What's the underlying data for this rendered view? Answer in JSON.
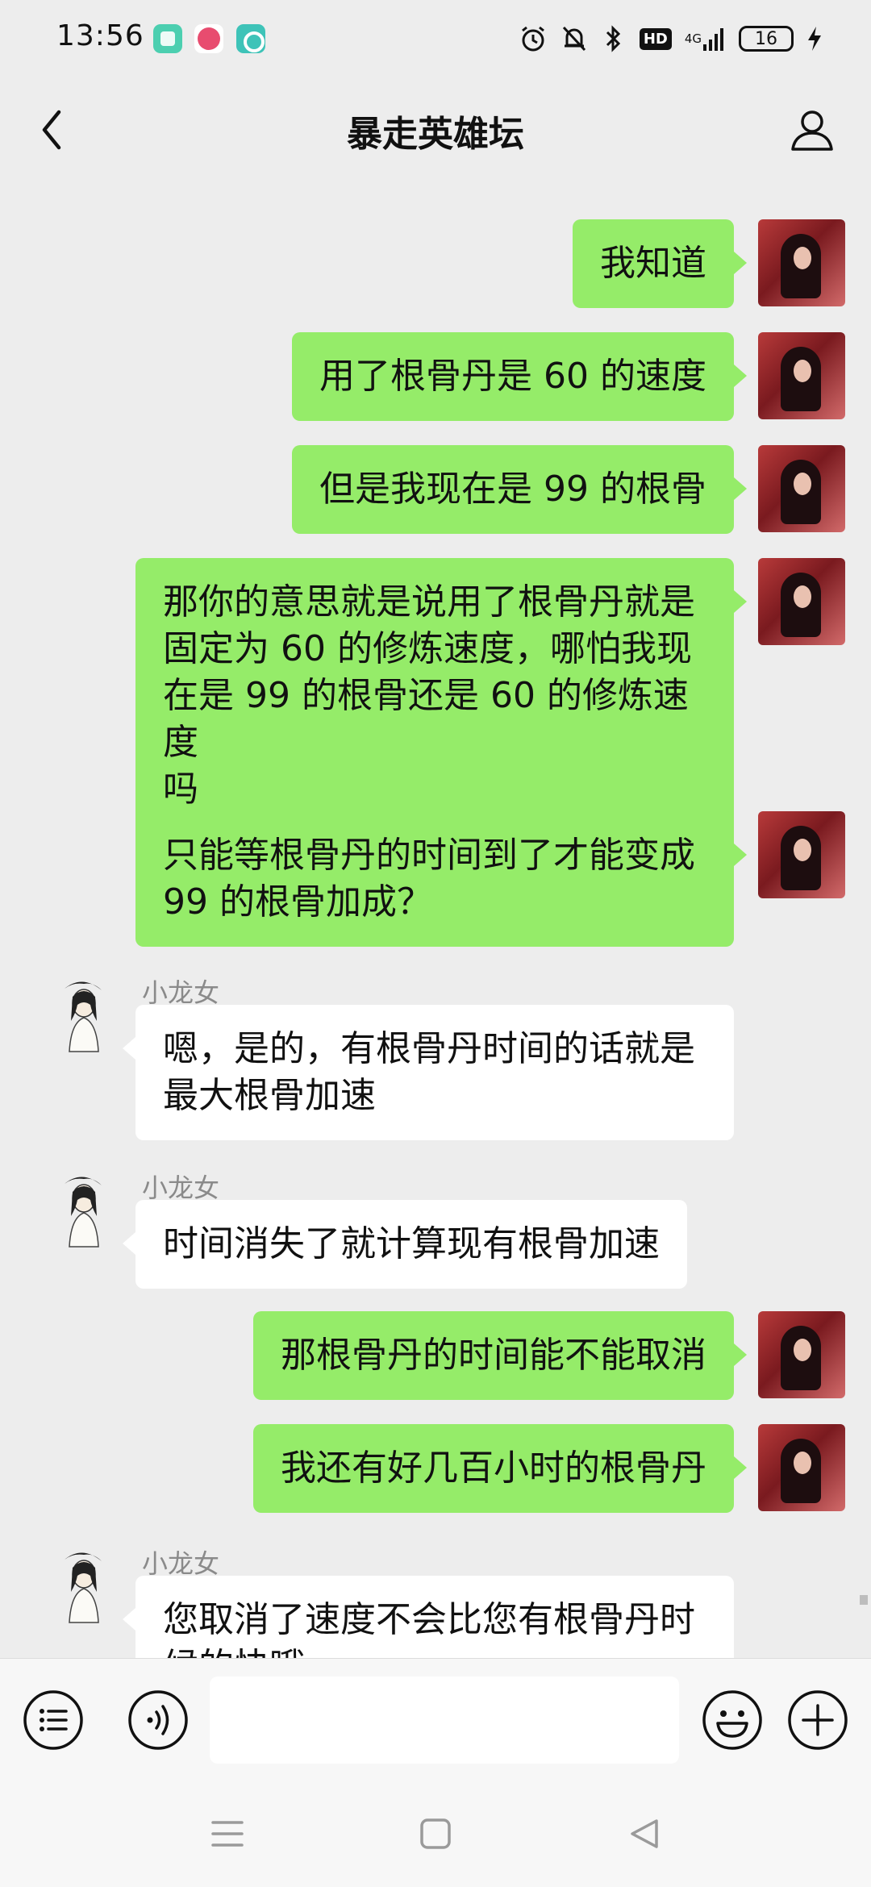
{
  "status_bar": {
    "time": "13:56",
    "hd": "HD",
    "network": "4G",
    "battery": "16"
  },
  "header": {
    "title": "暴走英雄坛"
  },
  "messages": [
    {
      "side": "self",
      "text": "我知道"
    },
    {
      "side": "self",
      "text": "用了根骨丹是 60 的速度"
    },
    {
      "side": "self",
      "text": "但是我现在是 99 的根骨"
    },
    {
      "side": "self",
      "lines": [
        "那你的意思就是说用了根骨丹就是",
        "固定为 60 的修炼速度，哪怕我现",
        "在是 99 的根骨还是 60 的修炼速度",
        "吗"
      ]
    },
    {
      "side": "self",
      "lines": [
        "只能等根骨丹的时间到了才能变成",
        "99 的根骨加成？"
      ]
    },
    {
      "side": "other",
      "name": "小龙女",
      "lines": [
        "嗯，是的，有根骨丹时间的话就是",
        "最大根骨加速"
      ]
    },
    {
      "side": "other",
      "name": "小龙女",
      "text": "时间消失了就计算现有根骨加速"
    },
    {
      "side": "self",
      "text": "那根骨丹的时间能不能取消"
    },
    {
      "side": "self",
      "text": "我还有好几百小时的根骨丹"
    },
    {
      "side": "other",
      "name": "小龙女",
      "lines": [
        "您取消了速度不会比您有根骨丹时",
        "候的快哦"
      ]
    }
  ],
  "input_bar": {
    "placeholder": ""
  },
  "icons": {
    "back": "chevron-left-icon",
    "profile": "person-icon",
    "menu": "list-icon",
    "voice": "voice-icon",
    "emoji": "emoji-icon",
    "add": "plus-icon"
  },
  "colors": {
    "self_bubble": "#95ec69",
    "other_bubble": "#ffffff",
    "background": "#ededed"
  }
}
